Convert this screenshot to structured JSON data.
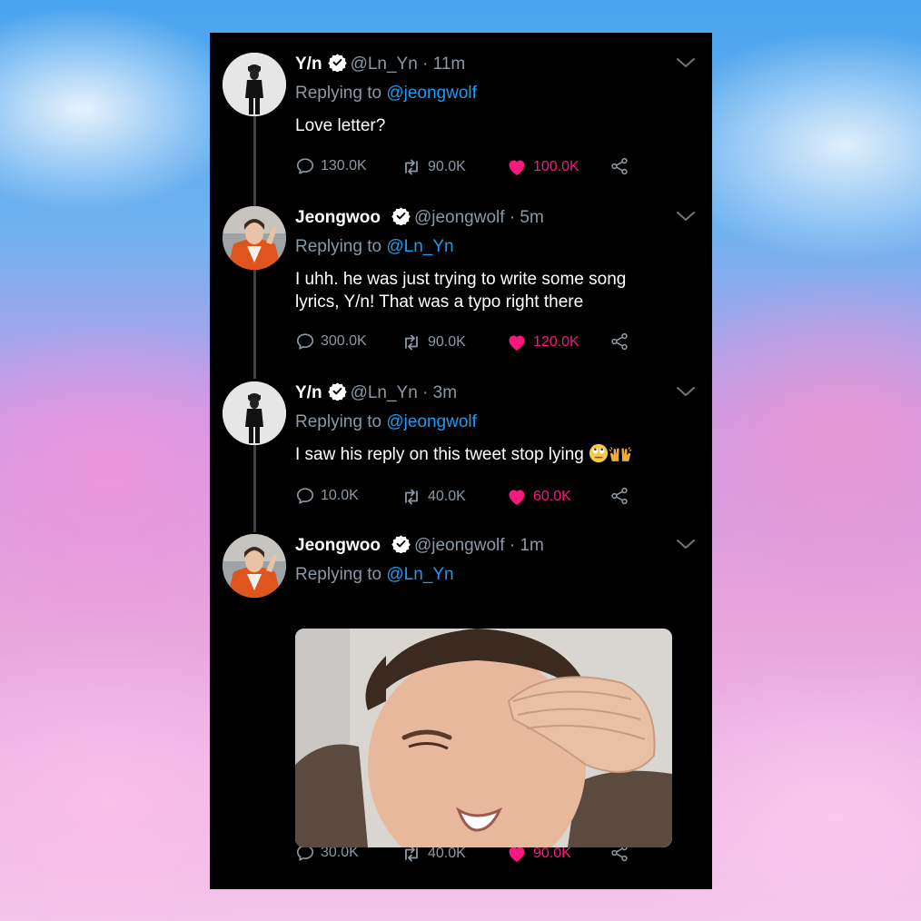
{
  "colors": {
    "background": "#000000",
    "text": "#ffffff",
    "secondary": "#8b98a5",
    "link": "#1d9bf0",
    "like": "#f91880",
    "verified": "#ffffff"
  },
  "tweets": [
    {
      "name": "Y/n",
      "handle": "@Ln_Yn",
      "time": "· 11m",
      "replying_prefix": "Replying to",
      "replying_to": "@jeongwolf",
      "text": "Love letter?",
      "replies": "130.0K",
      "retweets": "90.0K",
      "likes": "100.0K"
    },
    {
      "name": "Jeongwoo",
      "handle": "@jeongwolf",
      "time": "· 5m",
      "replying_prefix": "Replying to",
      "replying_to": "@Ln_Yn",
      "text_line1": "I uhh. he was just trying to write some song",
      "text_line2": "lyrics, Y/n! That was a typo right there",
      "replies": "300.0K",
      "retweets": "90.0K",
      "likes": "120.0K"
    },
    {
      "name": "Y/n",
      "handle": "@Ln_Yn",
      "time": "· 3m",
      "replying_prefix": "Replying to",
      "replying_to": "@jeongwolf",
      "text": "I saw his reply on this tweet stop lying",
      "emojis": [
        "eye-roll-emoji",
        "raised-hands-emoji"
      ],
      "replies": "10.0K",
      "retweets": "40.0K",
      "likes": "60.0K"
    },
    {
      "name": "Jeongwoo",
      "handle": "@jeongwolf",
      "time": "· 1m",
      "replying_prefix": "Replying to",
      "replying_to": "@Ln_Yn",
      "media": "crying-boy-photo",
      "replies": "30.0K",
      "retweets": "40.0K",
      "likes": "90.0K"
    }
  ],
  "icons": [
    "reply-icon",
    "retweet-icon",
    "like-icon",
    "share-icon",
    "verified-icon",
    "chevron-down-icon"
  ]
}
